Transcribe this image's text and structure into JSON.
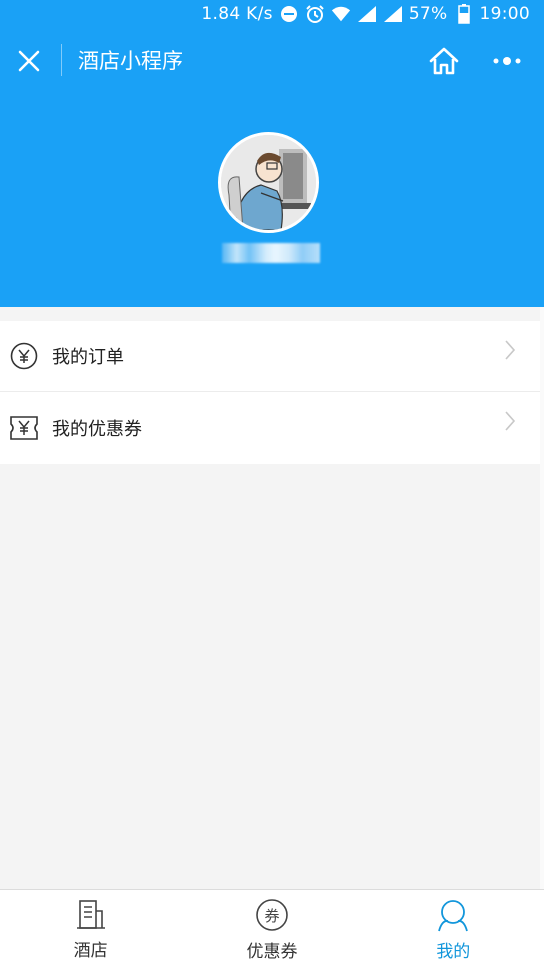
{
  "status_bar": {
    "speed": "1.84 K/s",
    "battery": "57%",
    "time": "19:00",
    "icons": [
      "do-not-disturb-icon",
      "alarm-icon",
      "wifi-icon",
      "signal-icon",
      "battery-icon"
    ]
  },
  "nav": {
    "title": "酒店小程序",
    "close_icon": "close-icon",
    "home_icon": "home-icon",
    "more_icon": "more-icon"
  },
  "profile": {
    "avatar_icon": "avatar-image",
    "username": ""
  },
  "menu": {
    "items": [
      {
        "label": "我的订单",
        "icon": "yen-circle-icon"
      },
      {
        "label": "我的优惠券",
        "icon": "coupon-icon"
      }
    ]
  },
  "tabbar": {
    "tabs": [
      {
        "label": "酒店",
        "icon": "hotel-icon",
        "active": false
      },
      {
        "label": "优惠券",
        "icon": "coupon-circle-icon",
        "active": false
      },
      {
        "label": "我的",
        "icon": "user-icon",
        "active": true
      }
    ]
  },
  "colors": {
    "brand": "#1aa1f6",
    "active_tab": "#1296db",
    "background": "#f4f4f4"
  }
}
